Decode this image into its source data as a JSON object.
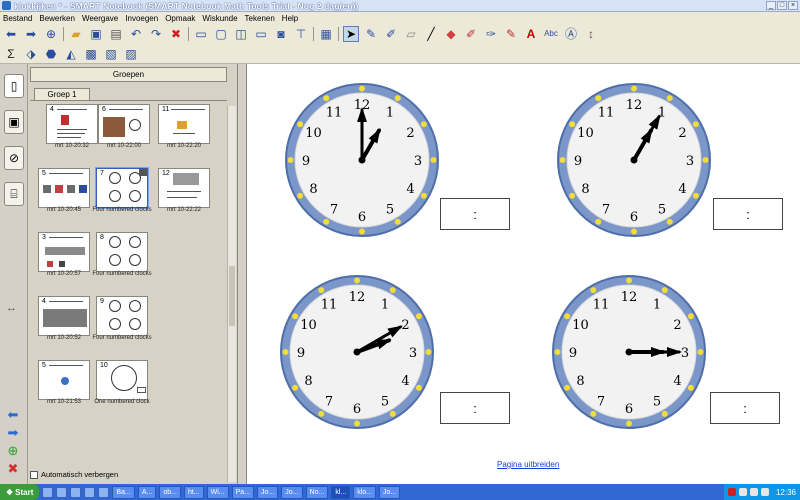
{
  "window": {
    "title": "klokkijken * - SMART Notebook (SMART Notebook Math Tools Trial - Nog 2 dag(en))",
    "controls": [
      "_",
      "□",
      "×"
    ]
  },
  "menu": [
    "Bestand",
    "Bewerken",
    "Weergave",
    "Invoegen",
    "Opmaak",
    "Wiskunde",
    "Tekenen",
    "Help"
  ],
  "toolbar1_icons": [
    "back-arrow-icon",
    "forward-arrow-icon",
    "add-page-icon",
    "open-folder-icon",
    "save-icon",
    "paste-icon",
    "undo-icon",
    "redo-icon",
    "delete-icon",
    "screen-shade-icon",
    "full-screen-icon",
    "dual-page-icon",
    "display-icon",
    "capture-icon",
    "document-camera-icon",
    "table-icon",
    "select-icon",
    "pen-icon",
    "creative-pen-icon",
    "eraser-icon",
    "line-icon",
    "shapes-icon",
    "fill-icon",
    "magic-pen-icon",
    "property-icon",
    "text-icon",
    "handwriting-icon",
    "math-icon",
    "more-icon"
  ],
  "toolbar2_icons": [
    "sigma-icon",
    "shape-tool-icon",
    "measure-icon",
    "protractor-icon",
    "graph-icon",
    "table-edit-icon",
    "ruler-icon"
  ],
  "sorter": {
    "groups_label": "Groepen",
    "group_tab": "Groep 1",
    "autohide_label": "Automatisch verbergen",
    "thumbnails": [
      {
        "num": "4",
        "caption": "mrt 10-20:32"
      },
      {
        "num": "6",
        "caption": "mrt 10-22:00"
      },
      {
        "num": "11",
        "caption": "mrt 10-22:20"
      },
      {
        "num": "5",
        "caption": "mrt 10-20:45"
      },
      {
        "num": "7",
        "caption": "Four numbered clocks"
      },
      {
        "num": "12",
        "caption": "mrt 10-22:22"
      },
      {
        "num": "3",
        "caption": "mrt 10-20:57"
      },
      {
        "num": "8",
        "caption": "Four numbered clocks"
      },
      {
        "num": "4",
        "caption": "mrt 10-20:52"
      },
      {
        "num": "9",
        "caption": "Four numbered clocks"
      },
      {
        "num": "5",
        "caption": "mrt 10-21:53"
      },
      {
        "num": "10",
        "caption": "One numbered clock"
      }
    ]
  },
  "canvas": {
    "numerals": [
      "12",
      "1",
      "2",
      "3",
      "4",
      "5",
      "6",
      "7",
      "8",
      "9",
      "10",
      "11"
    ],
    "clocks": [
      {
        "hour_deg": 30,
        "minute_deg": 0
      },
      {
        "hour_deg": 30,
        "minute_deg": 30
      },
      {
        "hour_deg": 70,
        "minute_deg": 60
      },
      {
        "hour_deg": 90,
        "minute_deg": 90
      }
    ],
    "time_boxes": [
      ":",
      ":",
      ":",
      ":"
    ],
    "page_link": "Pagina uitbreiden",
    "colors": {
      "rim": "#7b96c8",
      "rim_dark": "#4f6fa8",
      "face": "#f2f2f2",
      "dot": "#f2dc3a",
      "hand": "#000000"
    }
  },
  "taskbar": {
    "start_label": "Start",
    "buttons": [
      "Ba...",
      "A...",
      "ob...",
      "ht...",
      "Wi...",
      "Pa...",
      "Jo...",
      "Jo...",
      "No...",
      "kl...",
      "klo...",
      "Jo..."
    ],
    "active_index": 9,
    "clock": "12:36"
  }
}
